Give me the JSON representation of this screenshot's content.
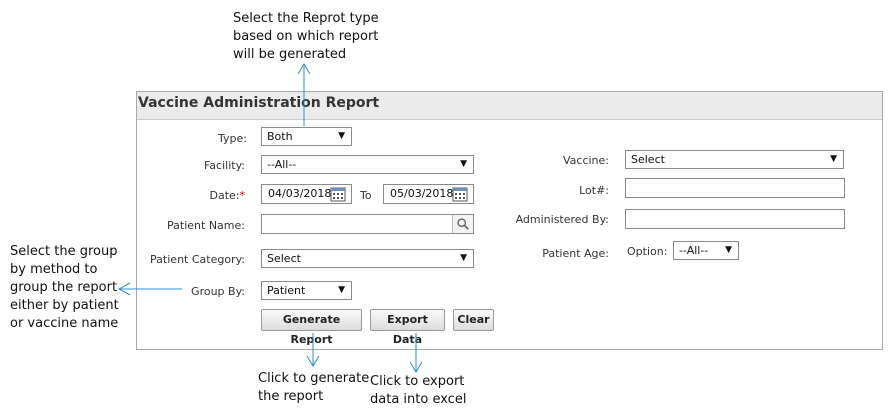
{
  "annotations": {
    "type_note": "Select the Reprot type\nbased on which report\nwill be generated",
    "group_note": "Select the group\nby method to\ngroup the report\neither by patient\nor vaccine name",
    "generate_note": "Click to generate\nthe report",
    "export_note": "Click to export\ndata into excel"
  },
  "panel": {
    "title": "Vaccine Administration Report"
  },
  "form": {
    "type": {
      "label": "Type:",
      "value": "Both"
    },
    "facility": {
      "label": "Facility:",
      "value": "--All--"
    },
    "date": {
      "label": "Date:",
      "required_mark": "*",
      "from": "04/03/2018",
      "to_label": "To",
      "to": "05/03/2018"
    },
    "patient_name": {
      "label": "Patient Name:",
      "value": ""
    },
    "patient_category": {
      "label": "Patient Category:",
      "value": "Select"
    },
    "group_by": {
      "label": "Group By:",
      "value": "Patient"
    },
    "vaccine": {
      "label": "Vaccine:",
      "value": "Select"
    },
    "lot": {
      "label": "Lot#:",
      "value": ""
    },
    "administered_by": {
      "label": "Administered By:",
      "value": ""
    },
    "patient_age": {
      "label": "Patient Age:",
      "option_label": "Option:",
      "value": "--All--"
    }
  },
  "buttons": {
    "generate": "Generate Report",
    "export": "Export Data",
    "clear": "Clear"
  },
  "icons": [
    "calendar-icon",
    "search-icon",
    "chevron-down-icon"
  ],
  "colors": {
    "accent_arrow": "#2a8fd0",
    "required": "#d00000",
    "header_bg": "#ebebeb"
  }
}
